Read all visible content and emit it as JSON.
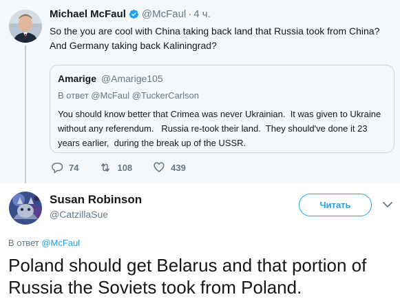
{
  "parent_tweet": {
    "author_name": "Michael McFaul",
    "handle": "@McFaul",
    "separator": "·",
    "time": "4 ч.",
    "text_line1": "So the you are cool with China taking back land that Russia took from China?",
    "text_line2": "And Germany taking back Kaliningrad?",
    "verified_icon": "verified-badge-icon",
    "quote": {
      "author_name": "Amarige",
      "handle": "@Amarige105",
      "reply_to": "В ответ @McFaul @TuckerCarlson",
      "text": "You should know better that Crimea was never Ukrainian.  It was given to Ukraine  without any referendum.   Russia re-took their land.  They should've done it 23 years earlier,  during the break up of the USSR."
    },
    "actions": {
      "replies": "74",
      "retweets": "108",
      "likes": "439"
    }
  },
  "main_tweet": {
    "author_name": "Susan Robinson",
    "handle": "@CatzillaSue",
    "follow_label": "Читать",
    "reply_prefix": "В ответ ",
    "reply_handle": "@McFaul",
    "text": "Poland should get Belarus and that portion of Russia the Soviets took from Poland."
  },
  "colors": {
    "accent": "#1da1f2",
    "muted": "#657786",
    "text": "#14171a",
    "parent_bg": "#f5f8fa"
  }
}
